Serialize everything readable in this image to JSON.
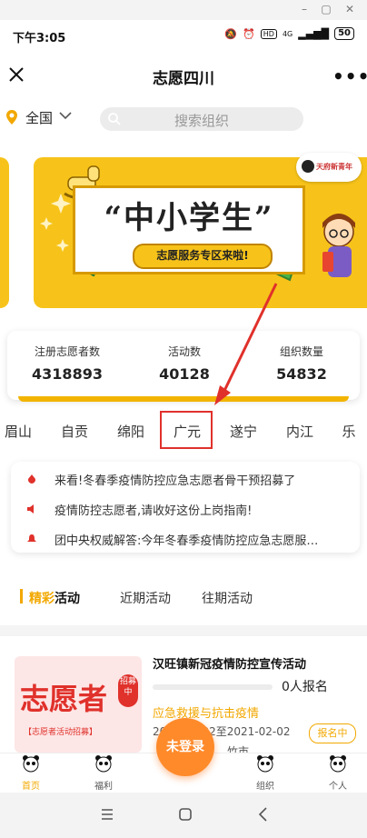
{
  "window": {
    "min": "–",
    "max": "▢",
    "close": "✕"
  },
  "status_bar": {
    "time": "下午3:05",
    "signal_text": "4G",
    "hd": "HD",
    "battery": "50"
  },
  "header": {
    "title": "志愿四川",
    "close_icon": "close-icon",
    "more_icon": "more-icon",
    "more": "•••"
  },
  "location": {
    "value": "全国"
  },
  "search": {
    "placeholder": "搜索组织"
  },
  "banner": {
    "title": "“中小学生”",
    "subtitle": "志愿服务专区来啦!",
    "logo_text": "天府新青年"
  },
  "stats": [
    {
      "label": "注册志愿者数",
      "value": "4318893"
    },
    {
      "label": "活动数",
      "value": "40128"
    },
    {
      "label": "组织数量",
      "value": "54832"
    }
  ],
  "cities": [
    "眉山",
    "自贡",
    "绵阳",
    "广元",
    "遂宁",
    "内江",
    "乐"
  ],
  "selected_city": "广元",
  "notices": [
    {
      "icon": "flame-icon",
      "color": "#e0312b",
      "text": "来看!冬春季疫情防控应急志愿者骨干预招募了"
    },
    {
      "icon": "speaker-icon",
      "color": "#e0312b",
      "text": "疫情防控志愿者,请收好这份上岗指南!"
    },
    {
      "icon": "bell-icon",
      "color": "#e0312b",
      "text": "团中央权威解答:今年冬春季疫情防控应急志愿服…"
    }
  ],
  "activity_tabs": {
    "active_a": "精彩",
    "active_b": "活动",
    "recent": "近期活动",
    "past": "往期活动"
  },
  "activity": {
    "title": "汉旺镇新冠疫情防控宣传活动",
    "progress": 0,
    "signups": "0人报名",
    "tag": "应急救援与抗击疫情",
    "date_start": "2021-02-02",
    "date_to": "至",
    "date_end": "2021-02-02",
    "status": "报名中",
    "location_fragment": "竹市",
    "thumb_text": "志愿者",
    "thumb_sub": "【志愿者活动招募】",
    "thumb_badge": "招募中"
  },
  "bottom_nav": {
    "home": "首页",
    "welfare": "福利",
    "login": "未登录",
    "org": "组织",
    "me": "个人"
  },
  "colors": {
    "accent": "#f2a800",
    "banner": "#f7c31a",
    "highlight_red": "#e0312b",
    "fab": "#ff8a2a"
  }
}
